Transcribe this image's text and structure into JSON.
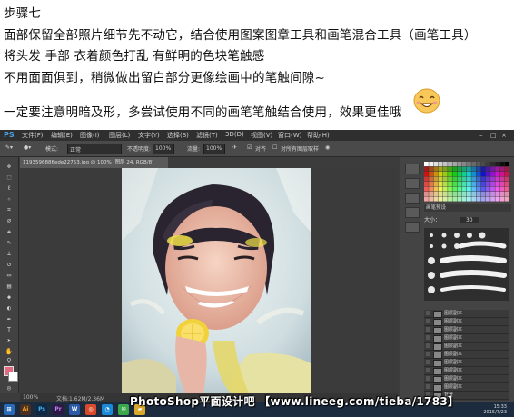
{
  "article": {
    "heading": "步骤七",
    "line1": "面部保留全部照片细节先不动它，结合使用图案图章工具和画笔混合工具（画笔工具）",
    "line2": "将头发 手部 衣着颜色打乱 有鲜明的色块笔触感",
    "line3": "不用面面俱到，稍微做出留白部分更像绘画中的笔触间隙~",
    "line4": "一定要注意明暗及形，多尝试使用不同的画笔笔触结合使用，效果更佳哦",
    "emoji": "smile-emoticon"
  },
  "photoshop": {
    "logo": "PS",
    "menus": [
      "文件(F)",
      "编辑(E)",
      "图像(I)",
      "图层(L)",
      "文字(Y)",
      "选择(S)",
      "滤镜(T)",
      "3D(D)",
      "视图(V)",
      "窗口(W)",
      "帮助(H)"
    ],
    "options": {
      "mode_label": "模式:",
      "mode_value": "正常",
      "opacity_label": "不透明度:",
      "opacity_value": "100%",
      "flow_label": "流量:",
      "flow_value": "100%",
      "aligned_label": "对齐",
      "sample_label": "对所有图层取样"
    },
    "doc_tab": "1193596886ede22753.jpg @ 100% (图层 24, RGB/8)",
    "status": {
      "zoom": "100%",
      "doc": "文档:1.62M/2.36M"
    },
    "brush_panel": {
      "size_label": "大小：",
      "size_value": "30",
      "preset_label": "画笔预设"
    },
    "layers": [
      "图层副本",
      "图层副本",
      "图层副本",
      "图层副本",
      "图层副本",
      "图层副本",
      "图层副本",
      "图层副本",
      "图层副本",
      "图层副本",
      "背景"
    ],
    "colors": {
      "foreground": "#e36a7e",
      "background": "#ffffff",
      "ui_dark": "#3c3c3c"
    }
  },
  "taskbar": {
    "apps": [
      "Ai",
      "Ps",
      "Pr",
      "W",
      "chrome",
      "qq",
      "wechat",
      "folder"
    ],
    "time": "15:33",
    "date": "2015/7/23"
  },
  "watermark": "PhotoShop平面设计吧 【www.lineeg.com/tieba/1783】"
}
